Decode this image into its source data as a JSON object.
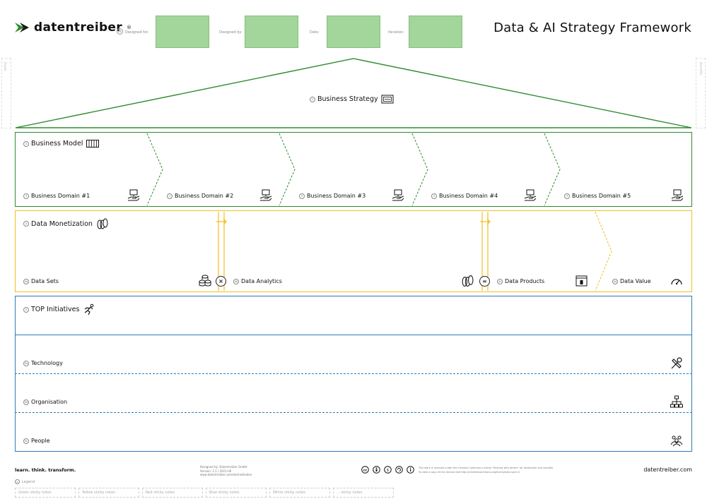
{
  "header": {
    "brand": "datentreiber",
    "brand_mark": "®",
    "meta_number": "01",
    "meta_fields": [
      "Designed for:",
      "Designed by:",
      "Date:",
      "Iteration:"
    ],
    "title": "Data & AI Strategy Framework"
  },
  "side_labels": {
    "left": "Goals",
    "right": "Benefits"
  },
  "strategy": {
    "num": "2",
    "label": "Business Strategy",
    "icon": "strategy-board-icon"
  },
  "business_model": {
    "num": "3",
    "label": "Business Model",
    "icon": "keyboard-icon",
    "domains": [
      {
        "num": "3",
        "label": "Business Domain #1"
      },
      {
        "num": "3",
        "label": "Business Domain #2"
      },
      {
        "num": "3",
        "label": "Business Domain #3"
      },
      {
        "num": "3",
        "label": "Business Domain #4"
      },
      {
        "num": "3",
        "label": "Business Domain #5"
      }
    ]
  },
  "data_monetization": {
    "num": "4",
    "label": "Data Monetization",
    "icon": "coins-icon",
    "items": [
      {
        "num": "4a",
        "label": "Data Sets"
      },
      {
        "num": "4b",
        "label": "Data Analytics"
      },
      {
        "num": "4c",
        "label": "Data Products"
      },
      {
        "num": "4d",
        "label": "Data Value"
      }
    ],
    "operators": [
      "×",
      "="
    ]
  },
  "initiatives": {
    "num": "5",
    "label": "TOP Initiatives",
    "icon": "runner-icon",
    "rows": [
      {
        "num": "5a",
        "label": "Technology",
        "icon": "tools-icon"
      },
      {
        "num": "5b",
        "label": "Organisation",
        "icon": "org-chart-icon"
      },
      {
        "num": "5c",
        "label": "People",
        "icon": "people-icon"
      }
    ]
  },
  "footer": {
    "tagline": "learn. think. transform.",
    "credits": [
      "Designed by: Datentreiber GmbH",
      "Version: 2.1 / 2021-06",
      "www.datentreiber.com/de/methoden"
    ],
    "license": [
      "This work is licensed under the Creative Commons License \"Sharing with others\" for attribution and conditions.",
      "To view a copy of this license visit http://creativecommons.org/licenses/by-sa/4.0/"
    ],
    "url": "datentreiber.com",
    "legend_num": "6",
    "legend_title": "Legend",
    "legend_items": [
      "Green sticky notes",
      "Yellow sticky notes",
      "Red sticky notes",
      "Blue sticky notes",
      "White sticky notes",
      "... sticky notes"
    ]
  },
  "colors": {
    "green": "#2e8b2e",
    "yellow": "#f2bd22",
    "blue": "#2b7bb9",
    "meta_box": "#a3d69b"
  }
}
